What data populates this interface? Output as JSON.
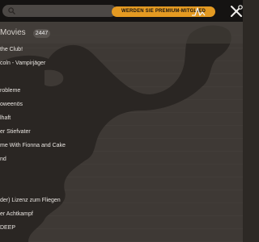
{
  "search": {
    "placeholder": ""
  },
  "header": {
    "premium_label": "WERDEN SIE PREMIUM-MITGLIED",
    "section_title": "Movies",
    "count": "2447",
    "partial_item": "...."
  },
  "icons": {
    "search": "search-icon",
    "activity": "activity-icon",
    "tools": "tools-icon"
  },
  "colors": {
    "accent": "#e49a22",
    "topbar": "#151312",
    "background": "#3e3935",
    "silhouette": "#2f2b28"
  },
  "list": {
    "items": [
      "the Club!",
      "coln - Vampirjäger",
      "",
      "robleme",
      "oweenös",
      "lhaft",
      "er Stiefvater",
      "me With Fionna and Cake",
      "nd",
      "",
      "",
      "der) Lizenz zum Fliegen",
      "er Achtkampf",
      "DEEP"
    ]
  }
}
